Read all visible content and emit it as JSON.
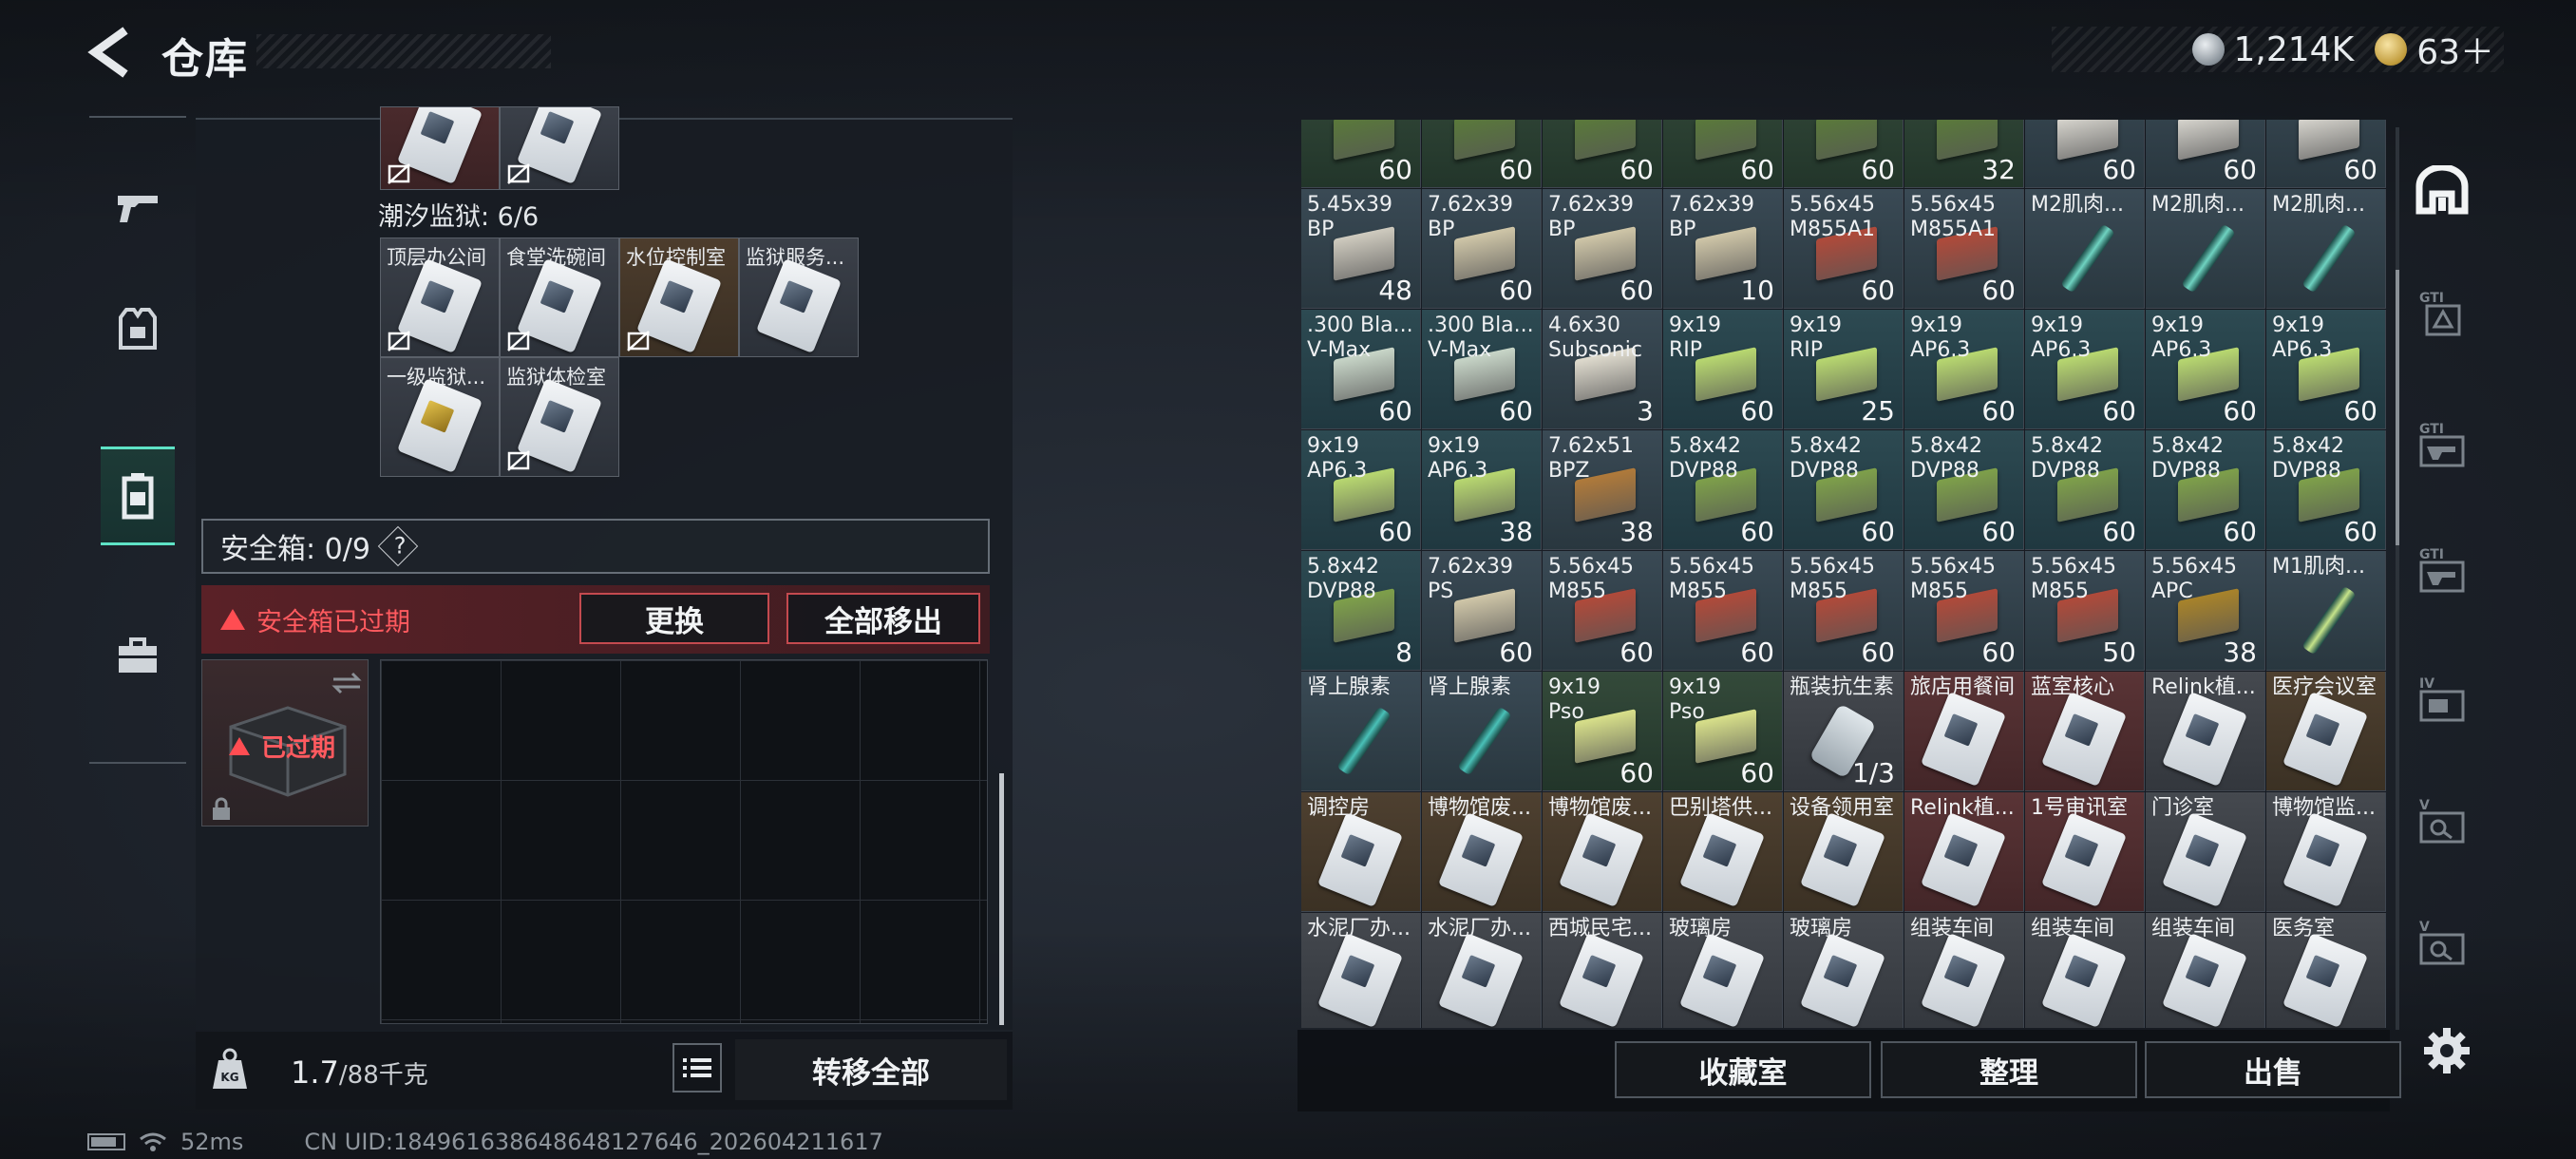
{
  "header": {
    "title": "仓库"
  },
  "currency": {
    "silver": "1,214K",
    "gold": "63＋"
  },
  "left": {
    "section_label": "潮汐监狱: 6/6",
    "keycards_row1": [
      "顶层办公间",
      "食堂洗碗间",
      "水位控制室",
      "监狱服务..."
    ],
    "keycards_row2": [
      "一级监狱...",
      "监狱体检室"
    ],
    "safe_label": "安全箱: 0/9",
    "safe_help": "?",
    "expired_warning": "安全箱已过期",
    "replace_button": "更换",
    "remove_all_button": "全部移出",
    "box_status": "已过期",
    "weight_value": "1.7",
    "weight_limit": "/88千克",
    "transfer_all": "转移全部"
  },
  "grid": {
    "row0": [
      {
        "label": "",
        "count": "60",
        "style": "ammo-grn",
        "kind": "ammo",
        "color": "#5a7a3a"
      },
      {
        "label": "",
        "count": "60",
        "style": "ammo-grn",
        "kind": "ammo",
        "color": "#5a7a3a"
      },
      {
        "label": "",
        "count": "60",
        "style": "ammo-grn",
        "kind": "ammo",
        "color": "#5a7a3a"
      },
      {
        "label": "",
        "count": "60",
        "style": "ammo-grn",
        "kind": "ammo",
        "color": "#5a7a3a"
      },
      {
        "label": "",
        "count": "60",
        "style": "ammo-grn",
        "kind": "ammo",
        "color": "#5a7a3a"
      },
      {
        "label": "",
        "count": "32",
        "style": "ammo-grn",
        "kind": "ammo",
        "color": "#5a7a3a"
      },
      {
        "label": "",
        "count": "60",
        "style": "ammo-g",
        "kind": "ammo",
        "color": "#d8d6cf"
      },
      {
        "label": "",
        "count": "60",
        "style": "ammo-g",
        "kind": "ammo",
        "color": "#d8d6cf"
      },
      {
        "label": "",
        "count": "60",
        "style": "ammo-g",
        "kind": "ammo",
        "color": "#d8d6cf"
      }
    ],
    "row1": [
      {
        "label": "5.45x39\nBP",
        "count": "48",
        "style": "ammo-g",
        "kind": "ammo",
        "color": "#cfcbbf"
      },
      {
        "label": "7.62x39\nBP",
        "count": "60",
        "style": "ammo-g",
        "kind": "ammo",
        "color": "#cfc6a8"
      },
      {
        "label": "7.62x39\nBP",
        "count": "60",
        "style": "ammo-g",
        "kind": "ammo",
        "color": "#cfc6a8"
      },
      {
        "label": "7.62x39\nBP",
        "count": "10",
        "style": "ammo-g",
        "kind": "ammo",
        "color": "#cfc6a8"
      },
      {
        "label": "5.56x45\nM855A1",
        "count": "60",
        "style": "ammo-g",
        "kind": "ammo",
        "color": "#b04a3a"
      },
      {
        "label": "5.56x45\nM855A1",
        "count": "60",
        "style": "ammo-g",
        "kind": "ammo",
        "color": "#b04a3a"
      },
      {
        "label": "M2肌肉...",
        "count": "",
        "style": "ammo-g",
        "kind": "syringe",
        "color": "#6fd3c1"
      },
      {
        "label": "M2肌肉...",
        "count": "",
        "style": "ammo-g",
        "kind": "syringe",
        "color": "#6fd3c1"
      },
      {
        "label": "M2肌肉...",
        "count": "",
        "style": "ammo-g",
        "kind": "syringe",
        "color": "#6fd3c1"
      }
    ],
    "row2": [
      {
        "label": ".300 Bla...\nV-Max",
        "count": "60",
        "style": "ammo-t",
        "kind": "ammo",
        "color": "#c8d6c8"
      },
      {
        "label": ".300 Bla...\nV-Max",
        "count": "60",
        "style": "ammo-t",
        "kind": "ammo",
        "color": "#c8d6c8"
      },
      {
        "label": "4.6x30\nSubsonic",
        "count": "3",
        "style": "ammo-g",
        "kind": "ammo",
        "color": "#e0dccf"
      },
      {
        "label": "9x19\nRIP",
        "count": "60",
        "style": "ammo-t",
        "kind": "ammo",
        "color": "#b8d870"
      },
      {
        "label": "9x19\nRIP",
        "count": "25",
        "style": "ammo-t",
        "kind": "ammo",
        "color": "#b8d870"
      },
      {
        "label": "9x19\nAP6.3",
        "count": "60",
        "style": "ammo-t",
        "kind": "ammo",
        "color": "#b8d870"
      },
      {
        "label": "9x19\nAP6.3",
        "count": "60",
        "style": "ammo-t",
        "kind": "ammo",
        "color": "#b8d870"
      },
      {
        "label": "9x19\nAP6.3",
        "count": "60",
        "style": "ammo-t",
        "kind": "ammo",
        "color": "#b8d870"
      },
      {
        "label": "9x19\nAP6.3",
        "count": "60",
        "style": "ammo-t",
        "kind": "ammo",
        "color": "#b8d870"
      }
    ],
    "row3": [
      {
        "label": "9x19\nAP6.3",
        "count": "60",
        "style": "ammo-t",
        "kind": "ammo",
        "color": "#b8d870"
      },
      {
        "label": "9x19\nAP6.3",
        "count": "38",
        "style": "ammo-t",
        "kind": "ammo",
        "color": "#b8d870"
      },
      {
        "label": "7.62x51\nBPZ",
        "count": "38",
        "style": "ammo-g",
        "kind": "ammo",
        "color": "#b07a3a"
      },
      {
        "label": "5.8x42\nDVP88",
        "count": "60",
        "style": "ammo-t",
        "kind": "ammo",
        "color": "#7ea04a"
      },
      {
        "label": "5.8x42\nDVP88",
        "count": "60",
        "style": "ammo-t",
        "kind": "ammo",
        "color": "#7ea04a"
      },
      {
        "label": "5.8x42\nDVP88",
        "count": "60",
        "style": "ammo-t",
        "kind": "ammo",
        "color": "#7ea04a"
      },
      {
        "label": "5.8x42\nDVP88",
        "count": "60",
        "style": "ammo-t",
        "kind": "ammo",
        "color": "#7ea04a"
      },
      {
        "label": "5.8x42\nDVP88",
        "count": "60",
        "style": "ammo-t",
        "kind": "ammo",
        "color": "#7ea04a"
      },
      {
        "label": "5.8x42\nDVP88",
        "count": "60",
        "style": "ammo-t",
        "kind": "ammo",
        "color": "#7ea04a"
      }
    ],
    "row4": [
      {
        "label": "5.8x42\nDVP88",
        "count": "8",
        "style": "ammo-t",
        "kind": "ammo",
        "color": "#7ea04a"
      },
      {
        "label": "7.62x39\nPS",
        "count": "60",
        "style": "ammo-g",
        "kind": "ammo",
        "color": "#cfc6a8"
      },
      {
        "label": "5.56x45\nM855",
        "count": "60",
        "style": "ammo-g",
        "kind": "ammo",
        "color": "#b04a3a"
      },
      {
        "label": "5.56x45\nM855",
        "count": "60",
        "style": "ammo-g",
        "kind": "ammo",
        "color": "#b04a3a"
      },
      {
        "label": "5.56x45\nM855",
        "count": "60",
        "style": "ammo-g",
        "kind": "ammo",
        "color": "#b04a3a"
      },
      {
        "label": "5.56x45\nM855",
        "count": "60",
        "style": "ammo-g",
        "kind": "ammo",
        "color": "#b04a3a"
      },
      {
        "label": "5.56x45\nM855",
        "count": "50",
        "style": "ammo-g",
        "kind": "ammo",
        "color": "#b04a3a"
      },
      {
        "label": "5.56x45\nAPC",
        "count": "38",
        "style": "ammo-g",
        "kind": "ammo",
        "color": "#a8832a"
      },
      {
        "label": "M1肌肉...",
        "count": "",
        "style": "ammo-g",
        "kind": "syringe",
        "color": "#c6e48a"
      }
    ],
    "row5": [
      {
        "label": "肾上腺素",
        "count": "",
        "style": "ammo-g",
        "kind": "syringe",
        "color": "#4ac1b8"
      },
      {
        "label": "肾上腺素",
        "count": "",
        "style": "ammo-g",
        "kind": "syringe",
        "color": "#4ac1b8"
      },
      {
        "label": "9x19\nPso",
        "count": "60",
        "style": "ammo-grn",
        "kind": "ammo",
        "color": "#d8e08a"
      },
      {
        "label": "9x19\nPso",
        "count": "60",
        "style": "ammo-grn",
        "kind": "ammo",
        "color": "#d8e08a"
      },
      {
        "label": "瓶装抗生素",
        "count": "1/3",
        "style": "kc",
        "kind": "bottle",
        "color": "#dfe6ea"
      },
      {
        "label": "旅店用餐间",
        "count": "",
        "style": "kcr",
        "kind": "card",
        "color": ""
      },
      {
        "label": "蓝室核心",
        "count": "",
        "style": "kcr",
        "kind": "card",
        "color": ""
      },
      {
        "label": "Relink植...",
        "count": "",
        "style": "kc",
        "kind": "card",
        "color": ""
      },
      {
        "label": "医疗会议室",
        "count": "",
        "style": "kcb",
        "kind": "card",
        "color": ""
      }
    ],
    "row6": [
      {
        "label": "调控房",
        "count": "",
        "style": "kcb",
        "kind": "card",
        "color": ""
      },
      {
        "label": "博物馆废...",
        "count": "",
        "style": "kcb",
        "kind": "card",
        "color": ""
      },
      {
        "label": "博物馆废...",
        "count": "",
        "style": "kcb",
        "kind": "card",
        "color": ""
      },
      {
        "label": "巴别塔供...",
        "count": "",
        "style": "kcb",
        "kind": "card",
        "color": ""
      },
      {
        "label": "设备领用室",
        "count": "",
        "style": "kcb",
        "kind": "card",
        "color": ""
      },
      {
        "label": "Relink植...",
        "count": "",
        "style": "kcr",
        "kind": "card",
        "color": ""
      },
      {
        "label": "1号审讯室",
        "count": "",
        "style": "kcr",
        "kind": "card",
        "color": ""
      },
      {
        "label": "门诊室",
        "count": "",
        "style": "kc",
        "kind": "card",
        "color": ""
      },
      {
        "label": "博物馆监...",
        "count": "",
        "style": "kc",
        "kind": "card",
        "color": ""
      }
    ],
    "row7": [
      {
        "label": "水泥厂办...",
        "count": "",
        "style": "kc",
        "kind": "card",
        "color": ""
      },
      {
        "label": "水泥厂办...",
        "count": "",
        "style": "kc",
        "kind": "card",
        "color": ""
      },
      {
        "label": "西城民宅...",
        "count": "",
        "style": "kc",
        "kind": "card",
        "color": ""
      },
      {
        "label": "玻璃房",
        "count": "",
        "style": "kc",
        "kind": "card",
        "color": ""
      },
      {
        "label": "玻璃房",
        "count": "",
        "style": "kc",
        "kind": "card",
        "color": ""
      },
      {
        "label": "组装车间",
        "count": "",
        "style": "kc",
        "kind": "card",
        "color": ""
      },
      {
        "label": "组装车间",
        "count": "",
        "style": "kc",
        "kind": "card",
        "color": ""
      },
      {
        "label": "组装车间",
        "count": "",
        "style": "kc",
        "kind": "card",
        "color": ""
      },
      {
        "label": "医务室",
        "count": "",
        "style": "kc",
        "kind": "card",
        "color": ""
      }
    ]
  },
  "bottom": {
    "collection": "收藏室",
    "sort": "整理",
    "sell": "出售"
  },
  "status": {
    "ping": "52ms",
    "uid": "CN UID:18496163864864812764​6_202604211617"
  },
  "colors": {
    "accent": "#5ee3c6",
    "warning": "#ff4d52"
  }
}
